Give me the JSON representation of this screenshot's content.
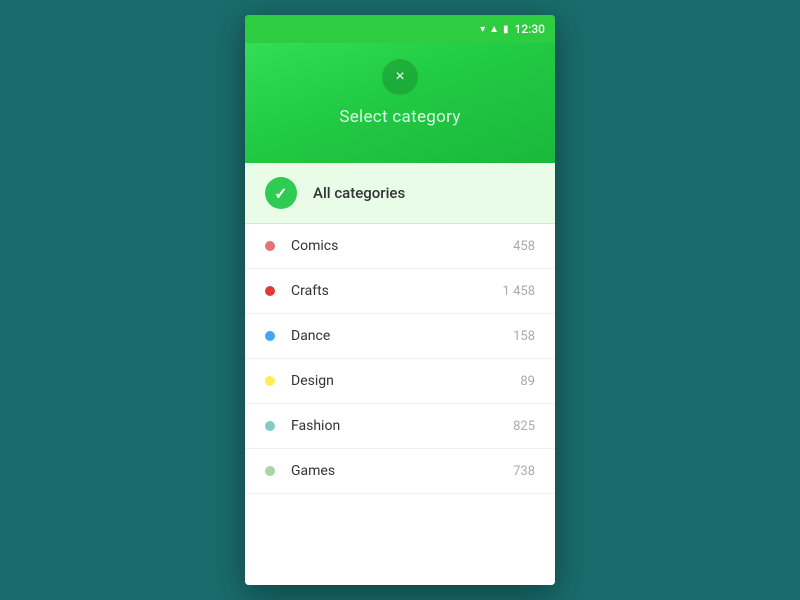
{
  "statusBar": {
    "time": "12:30"
  },
  "header": {
    "title": "Select category",
    "closeLabel": "×"
  },
  "allCategories": {
    "label": "All categories"
  },
  "categories": [
    {
      "name": "Comics",
      "count": "458",
      "color": "#e57373"
    },
    {
      "name": "Crafts",
      "count": "1 458",
      "color": "#e53935"
    },
    {
      "name": "Dance",
      "count": "158",
      "color": "#42a5f5"
    },
    {
      "name": "Design",
      "count": "89",
      "color": "#ffee58"
    },
    {
      "name": "Fashion",
      "count": "825",
      "color": "#80cbc4"
    },
    {
      "name": "Games",
      "count": "738",
      "color": "#a5d6a7"
    }
  ]
}
